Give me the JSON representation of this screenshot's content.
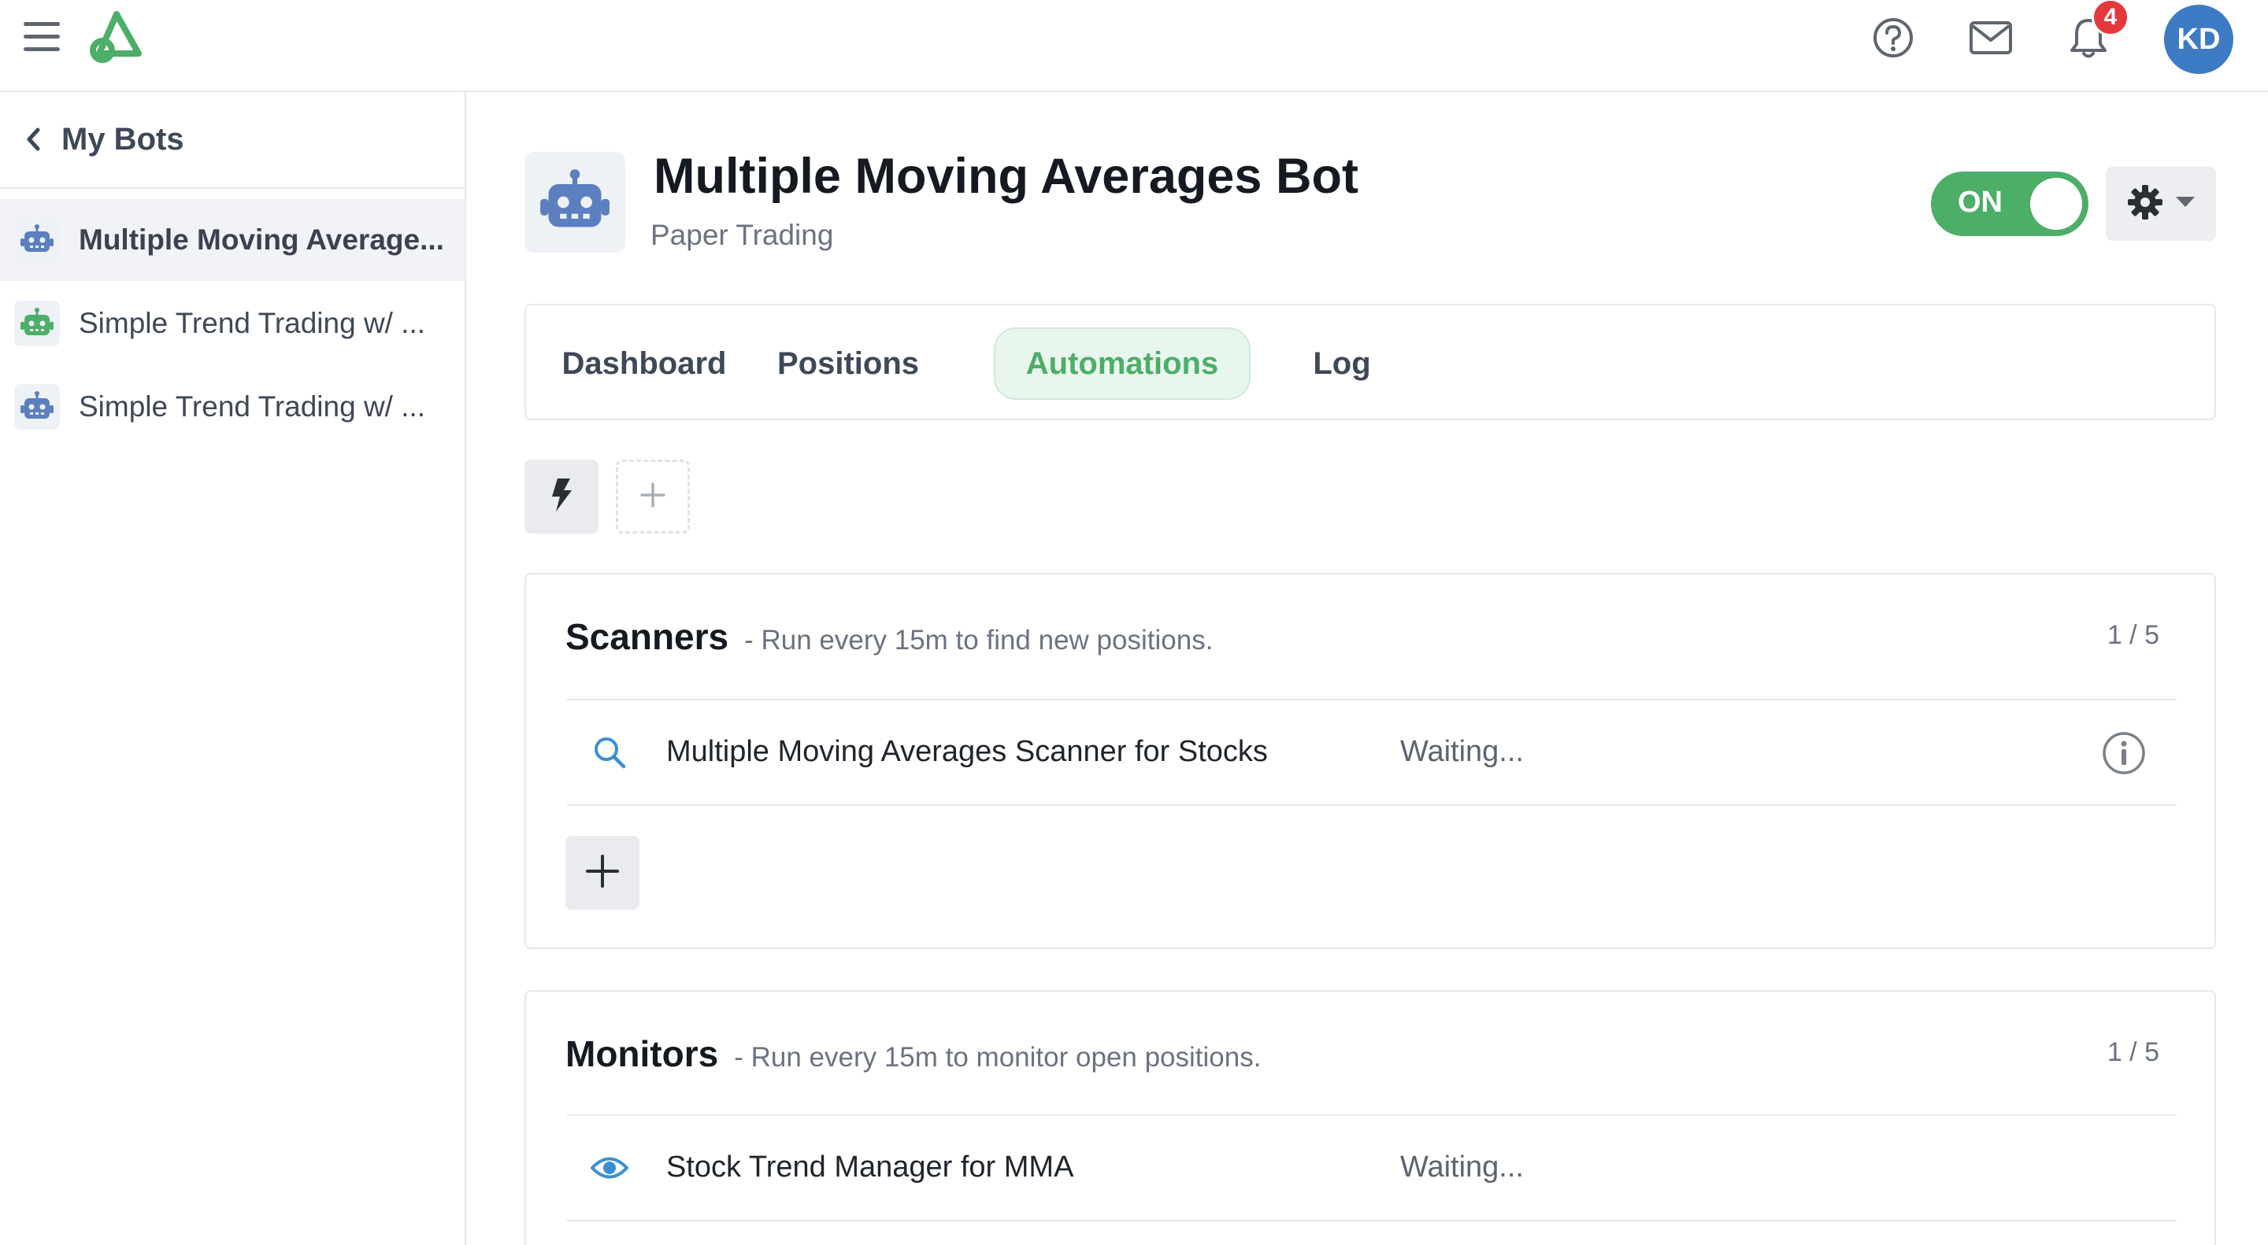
{
  "topbar": {
    "menu_icon": "hamburger-menu-icon",
    "logo_icon": "brand-logo-icon",
    "help_icon": "question-circle-icon",
    "mail_icon": "envelope-icon",
    "bell_icon": "bell-icon",
    "notification_count": "4",
    "avatar_initials": "KD"
  },
  "sidebar": {
    "back_label": "My Bots",
    "items": [
      {
        "label": "Multiple Moving Average...",
        "icon_color": "#5b7fbf",
        "active": true
      },
      {
        "label": "Simple Trend Trading w/ ...",
        "icon_color": "#4cae67",
        "active": false
      },
      {
        "label": "Simple Trend Trading w/ ...",
        "icon_color": "#5b7fbf",
        "active": false
      }
    ]
  },
  "bot": {
    "title": "Multiple Moving Averages Bot",
    "subtitle": "Paper Trading",
    "toggle_label": "ON",
    "toggle_on": true
  },
  "tabs": [
    {
      "label": "Dashboard",
      "active": false
    },
    {
      "label": "Positions",
      "active": false
    },
    {
      "label": "Automations",
      "active": true
    },
    {
      "label": "Log",
      "active": false
    }
  ],
  "scanners": {
    "title": "Scanners",
    "description": "- Run every 15m to find new positions.",
    "count": "1 / 5",
    "rows": [
      {
        "name": "Multiple Moving Averages Scanner for Stocks",
        "status": "Waiting...",
        "icon": "search-icon"
      }
    ]
  },
  "monitors": {
    "title": "Monitors",
    "description": "- Run every 15m to monitor open positions.",
    "count": "1 / 5",
    "rows": [
      {
        "name": "Stock Trend Manager for MMA",
        "status": "Waiting...",
        "icon": "eye-icon"
      }
    ]
  },
  "colors": {
    "accent_green": "#4cae67",
    "avatar_blue": "#3d7bc4",
    "badge_red": "#e5383b",
    "icon_blue": "#3b8fd0"
  }
}
